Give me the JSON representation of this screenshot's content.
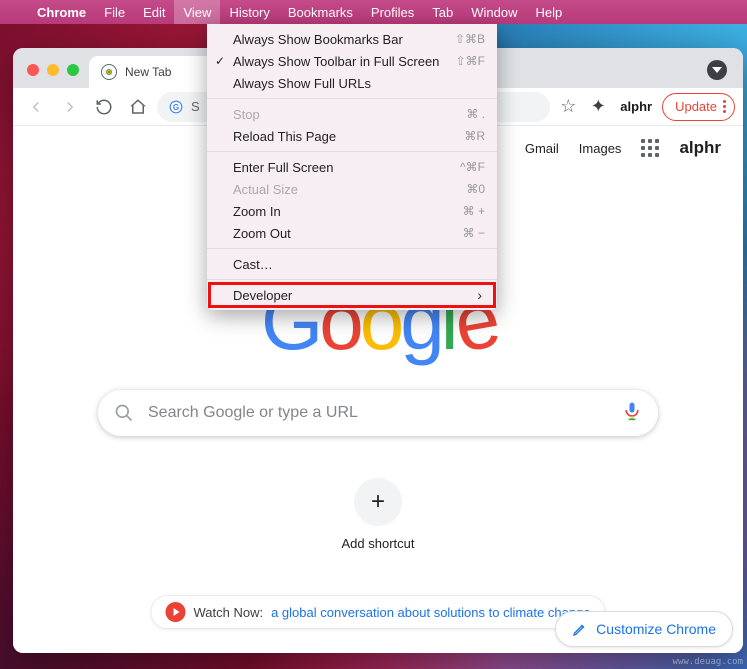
{
  "menubar": {
    "app": "Chrome",
    "items": [
      "File",
      "Edit",
      "View",
      "History",
      "Bookmarks",
      "Profiles",
      "Tab",
      "Window",
      "Help"
    ],
    "active": "View"
  },
  "dropdown": {
    "bookmarks_bar": {
      "label": "Always Show Bookmarks Bar",
      "shortcut": "⇧⌘B",
      "checked": false
    },
    "toolbar_full": {
      "label": "Always Show Toolbar in Full Screen",
      "shortcut": "⇧⌘F",
      "checked": true
    },
    "full_urls": {
      "label": "Always Show Full URLs",
      "shortcut": "",
      "checked": false
    },
    "stop": {
      "label": "Stop",
      "shortcut": "⌘ .",
      "disabled": true
    },
    "reload": {
      "label": "Reload This Page",
      "shortcut": "⌘R"
    },
    "enter_full": {
      "label": "Enter Full Screen",
      "shortcut": "^⌘F"
    },
    "actual": {
      "label": "Actual Size",
      "shortcut": "⌘0",
      "disabled": true
    },
    "zoom_in": {
      "label": "Zoom In",
      "shortcut": "⌘ +"
    },
    "zoom_out": {
      "label": "Zoom Out",
      "shortcut": "⌘ −"
    },
    "cast": {
      "label": "Cast…"
    },
    "developer": {
      "label": "Developer"
    }
  },
  "chrome": {
    "tab_title": "New Tab",
    "omnibox_prefix": "S",
    "update_label": "Update",
    "toolbar_brand": "alphr"
  },
  "ntp": {
    "links": {
      "gmail": "Gmail",
      "images": "Images"
    },
    "brand": "alphr",
    "logo_letters": [
      "G",
      "o",
      "o",
      "g",
      "l",
      "e"
    ],
    "search_placeholder": "Search Google or type a URL",
    "shortcut_label": "Add shortcut",
    "banner_lead": "Watch Now:",
    "banner_link": "a global conversation about solutions to climate change",
    "customize_label": "Customize Chrome"
  },
  "watermark": "www.deuag.com"
}
